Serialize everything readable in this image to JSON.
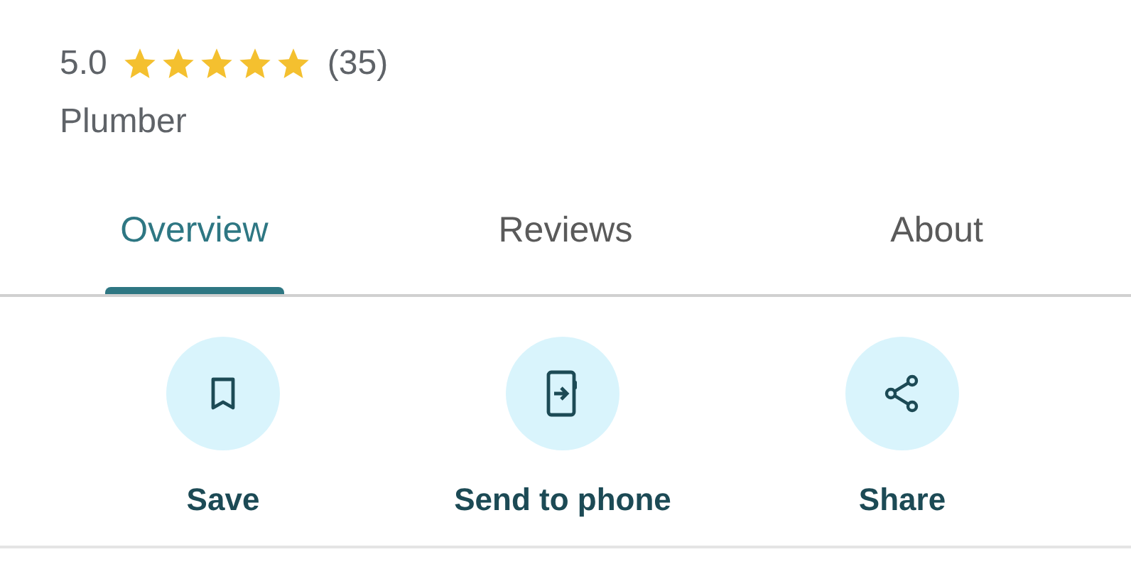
{
  "rating": {
    "value": "5.0",
    "stars": 5,
    "count": "(35)"
  },
  "category": "Plumber",
  "tabs": [
    {
      "label": "Overview",
      "selected": true
    },
    {
      "label": "Reviews",
      "selected": false
    },
    {
      "label": "About",
      "selected": false
    }
  ],
  "actions": [
    {
      "kind": "save",
      "label": "Save"
    },
    {
      "kind": "send",
      "label": "Send to phone"
    },
    {
      "kind": "share",
      "label": "Share"
    }
  ]
}
